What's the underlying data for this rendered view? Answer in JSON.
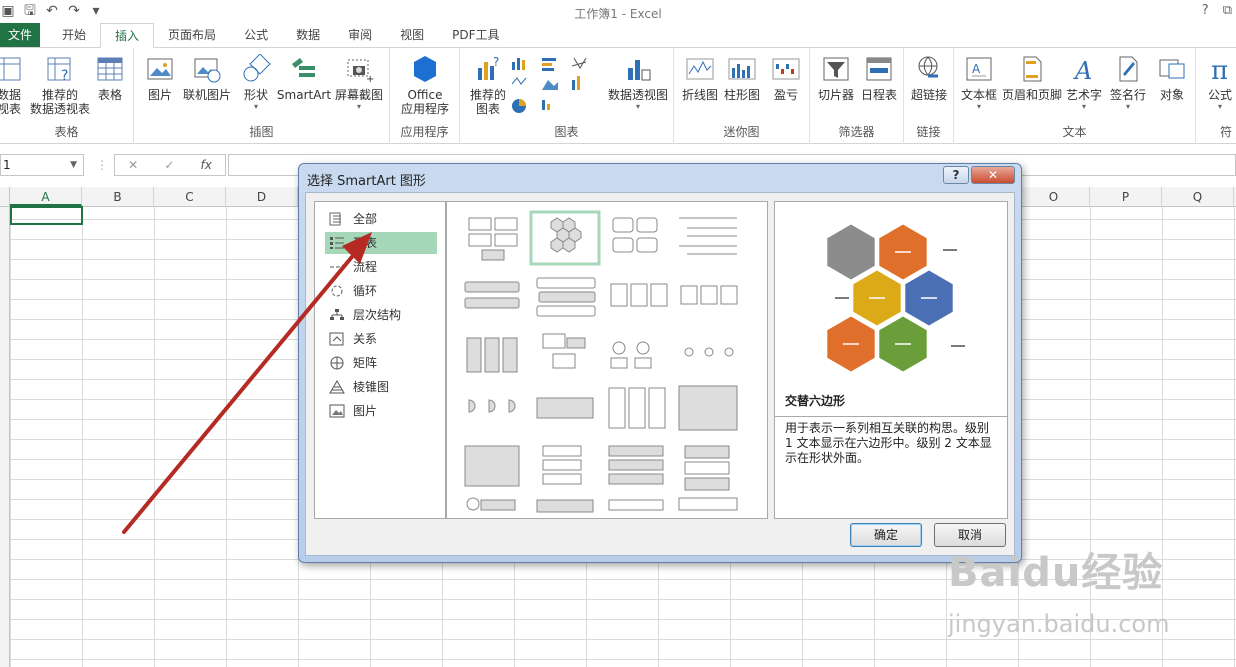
{
  "window": {
    "title": "工作簿1 - Excel",
    "help": "?"
  },
  "tabs": [
    "文件",
    "开始",
    "插入",
    "页面布局",
    "公式",
    "数据",
    "审阅",
    "视图",
    "PDF工具"
  ],
  "ribbon": {
    "groups": [
      {
        "label": "表格",
        "buttons": [
          "数据\n视表",
          "推荐的\n数据透视表",
          "表格"
        ]
      },
      {
        "label": "插图",
        "buttons": [
          "图片",
          "联机图片",
          "形状",
          "SmartArt",
          "屏幕截图"
        ]
      },
      {
        "label": "应用程序",
        "buttons": [
          "Office\n应用程序"
        ]
      },
      {
        "label": "图表",
        "buttons": [
          "推荐的\n图表",
          "数据透视图"
        ]
      },
      {
        "label": "迷你图",
        "buttons": [
          "折线图",
          "柱形图",
          "盈亏"
        ]
      },
      {
        "label": "筛选器",
        "buttons": [
          "切片器",
          "日程表"
        ]
      },
      {
        "label": "链接",
        "buttons": [
          "超链接"
        ]
      },
      {
        "label": "文本",
        "buttons": [
          "文本框",
          "页眉和页脚",
          "艺术字",
          "签名行",
          "对象"
        ]
      },
      {
        "label": "符",
        "buttons": [
          "公式"
        ]
      }
    ]
  },
  "formula_bar": {
    "name_box": "1",
    "cancel": "✕",
    "enter": "✓",
    "fx": "fx"
  },
  "columns": [
    "A",
    "B",
    "C",
    "D",
    "",
    "",
    "",
    "",
    "",
    "",
    "",
    "",
    "",
    "",
    "O",
    "P",
    "Q"
  ],
  "dialog": {
    "title": "选择 SmartArt 图形",
    "categories": [
      "全部",
      "列表",
      "流程",
      "循环",
      "层次结构",
      "关系",
      "矩阵",
      "棱锥图",
      "图片"
    ],
    "selected_category": "列表",
    "preview_name": "交替六边形",
    "preview_description": "用于表示一系列相互关联的构思。级别 1 文本显示在六边形中。级别 2 文本显示在形状外面。",
    "ok_label": "确定",
    "cancel_label": "取消",
    "hex_colors": [
      "#8c8c8c",
      "#e06f2b",
      "#dcaa16",
      "#4a6fb5",
      "#e06f2b",
      "#6a9e3a"
    ]
  },
  "watermark": {
    "brand": "Baidu经验",
    "url": "jingyan.baidu.com"
  }
}
